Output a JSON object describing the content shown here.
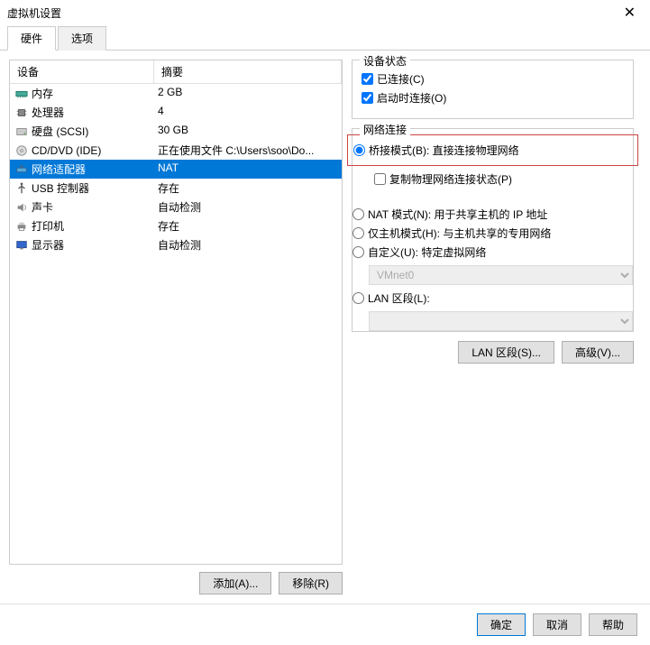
{
  "window": {
    "title": "虚拟机设置"
  },
  "tabs": {
    "hardware": "硬件",
    "options": "选项"
  },
  "table": {
    "header_device": "设备",
    "header_summary": "摘要",
    "rows": [
      {
        "name": "内存",
        "summary": "2 GB",
        "icon": "memory"
      },
      {
        "name": "处理器",
        "summary": "4",
        "icon": "cpu"
      },
      {
        "name": "硬盘 (SCSI)",
        "summary": "30 GB",
        "icon": "disk"
      },
      {
        "name": "CD/DVD (IDE)",
        "summary": "正在使用文件 C:\\Users\\soo\\Do...",
        "icon": "cd"
      },
      {
        "name": "网络适配器",
        "summary": "NAT",
        "icon": "net",
        "selected": true
      },
      {
        "name": "USB 控制器",
        "summary": "存在",
        "icon": "usb"
      },
      {
        "name": "声卡",
        "summary": "自动检测",
        "icon": "sound"
      },
      {
        "name": "打印机",
        "summary": "存在",
        "icon": "printer"
      },
      {
        "name": "显示器",
        "summary": "自动检测",
        "icon": "display"
      }
    ]
  },
  "left_buttons": {
    "add": "添加(A)...",
    "remove": "移除(R)"
  },
  "device_status": {
    "legend": "设备状态",
    "connected": "已连接(C)",
    "connect_at_power": "启动时连接(O)"
  },
  "network": {
    "legend": "网络连接",
    "bridged": "桥接模式(B): 直接连接物理网络",
    "replicate": "复制物理网络连接状态(P)",
    "nat": "NAT 模式(N): 用于共享主机的 IP 地址",
    "hostonly": "仅主机模式(H): 与主机共享的专用网络",
    "custom": "自定义(U): 特定虚拟网络",
    "custom_select": "VMnet0",
    "lan": "LAN 区段(L):",
    "lan_select": ""
  },
  "right_buttons": {
    "lan_segments": "LAN 区段(S)...",
    "advanced": "高级(V)..."
  },
  "footer": {
    "ok": "确定",
    "cancel": "取消",
    "help": "帮助"
  }
}
